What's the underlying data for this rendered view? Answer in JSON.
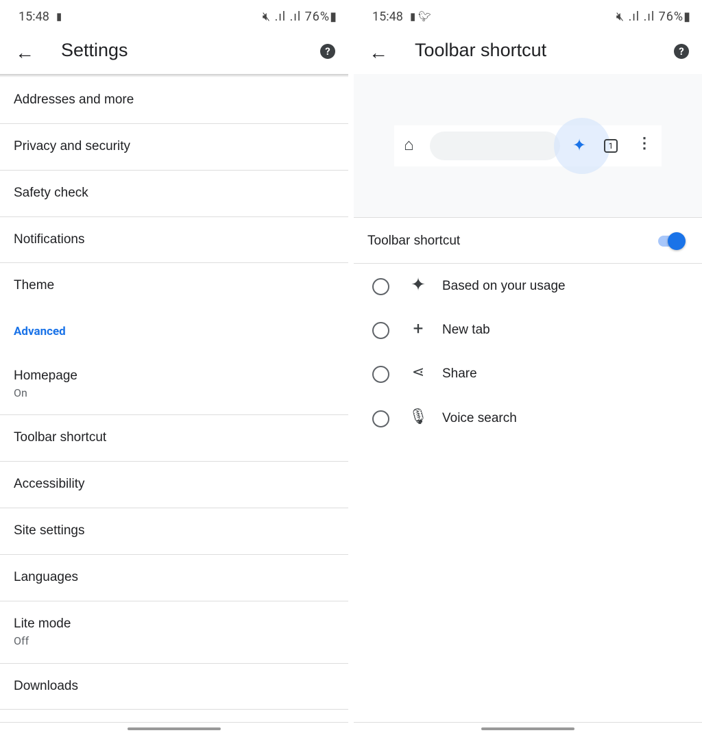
{
  "status": {
    "time": "15:48",
    "battery": "76%"
  },
  "left": {
    "title": "Settings",
    "items": [
      {
        "label": "Addresses and more"
      },
      {
        "label": "Privacy and security"
      },
      {
        "label": "Safety check"
      },
      {
        "label": "Notifications"
      },
      {
        "label": "Theme"
      }
    ],
    "advanced": "Advanced",
    "adv_items": [
      {
        "label": "Homepage",
        "sub": "On"
      },
      {
        "label": "Toolbar shortcut"
      },
      {
        "label": "Accessibility"
      },
      {
        "label": "Site settings"
      },
      {
        "label": "Languages"
      },
      {
        "label": "Lite mode",
        "sub": "Off"
      },
      {
        "label": "Downloads"
      }
    ]
  },
  "right": {
    "title": "Toolbar shortcut",
    "tab_count": "1",
    "toggle_label": "Toolbar shortcut",
    "toggle_on": true,
    "options": [
      {
        "label": "Based on your usage",
        "icon": "sparkle-icon",
        "selected": false
      },
      {
        "label": "New tab",
        "icon": "plus-icon",
        "selected": false
      },
      {
        "label": "Share",
        "icon": "share-icon",
        "selected": false
      },
      {
        "label": "Voice search",
        "icon": "mic-icon",
        "selected": false
      }
    ]
  },
  "colors": {
    "accent": "#1a73e8"
  }
}
